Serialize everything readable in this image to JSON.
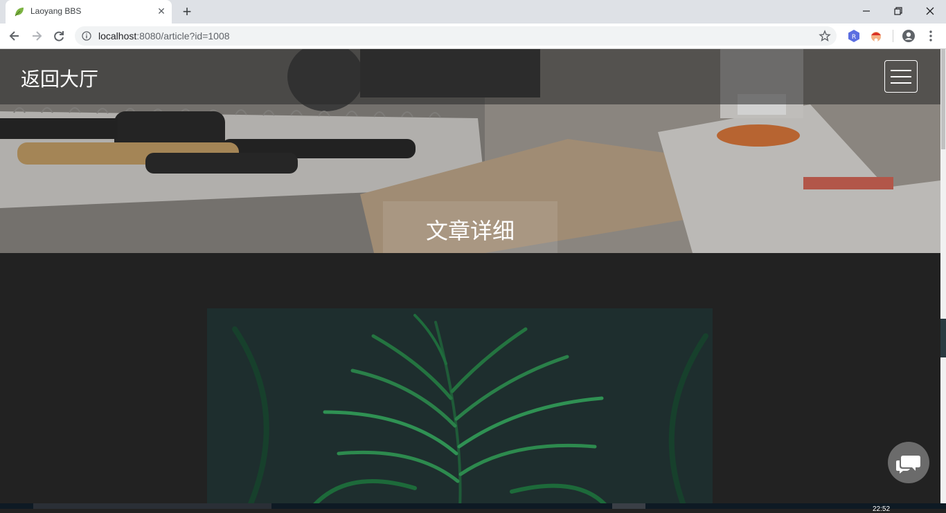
{
  "browser": {
    "tab": {
      "title": "Laoyang BBS",
      "favicon": "leaf-icon",
      "close_glyph": "✕"
    },
    "new_tab_glyph": "+",
    "address_bar": {
      "host": "localhost",
      "rest": ":8080/article?id=1008"
    },
    "icons": [
      "back-arrow-icon",
      "forward-arrow-icon",
      "reload-icon",
      "info-icon",
      "bookmark-star-icon",
      "extension-r-icon",
      "extension-avatar-icon",
      "profile-icon",
      "more-vertical-icon",
      "minimize-icon",
      "restore-icon",
      "close-icon"
    ]
  },
  "page": {
    "navbar": {
      "brand": "返回大厅",
      "toggle_icon": "hamburger-menu-icon"
    },
    "heading": "文章详细",
    "chat_icon": "chat-bubbles-icon"
  },
  "taskbar": {
    "clock_partial": "22:52"
  },
  "colors": {
    "tabstrip": "#dee1e6",
    "page_background": "#222222",
    "extension_accent": "#5b6ee1"
  }
}
